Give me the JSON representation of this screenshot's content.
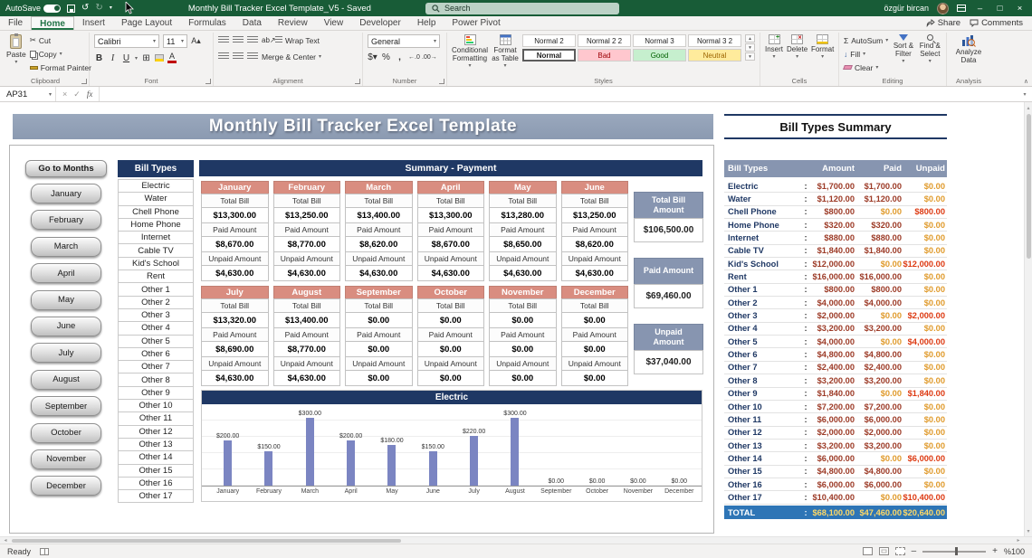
{
  "colors": {
    "titlebar-green": "#185c37",
    "tab-accent": "#217346",
    "navy": "#1f3864",
    "banner-blue": "#8b9ab1",
    "salmon": "#d98d80",
    "table-header": "#8795b0",
    "total-row-blue": "#2e75b6",
    "bar": "#7b85c2",
    "money": "#9c3a26",
    "zero-amount": "#e09b2d",
    "unpaid-pos": "#dd3a12",
    "total-values": "#ffd966",
    "bad-bg": "#ffc7ce",
    "bad-fg": "#9c0006",
    "good-bg": "#c6efce",
    "good-fg": "#006100",
    "neutral-bg": "#ffeb9c",
    "neutral-fg": "#9c6500"
  },
  "titlebar": {
    "autosave_label": "AutoSave",
    "autosave_state": "On",
    "doc_title": "Monthly Bill Tracker Excel Template_V5 - Saved",
    "search_placeholder": "Search",
    "user_name": "özgür bircan"
  },
  "ribbon": {
    "tabs": [
      "File",
      "Home",
      "Insert",
      "Page Layout",
      "Formulas",
      "Data",
      "Review",
      "View",
      "Developer",
      "Help",
      "Power Pivot"
    ],
    "active_tab": "Home",
    "share": "Share",
    "comments": "Comments",
    "groups": {
      "clipboard": {
        "label": "Clipboard",
        "paste": "Paste",
        "cut": "Cut",
        "copy": "Copy",
        "format_painter": "Format Painter"
      },
      "font": {
        "label": "Font",
        "family": "Calibri",
        "size": "11"
      },
      "alignment": {
        "label": "Alignment",
        "wrap_text": "Wrap Text",
        "merge_center": "Merge & Center"
      },
      "number": {
        "label": "Number",
        "format": "General"
      },
      "styles": {
        "label": "Styles",
        "conditional_formatting": "Conditional Formatting",
        "format_as_table": "Format as Table",
        "cell_styles": [
          {
            "name": "Normal 2",
            "kind": "plain"
          },
          {
            "name": "Normal 2 2",
            "kind": "plain"
          },
          {
            "name": "Normal 3",
            "kind": "plain"
          },
          {
            "name": "Normal 3 2",
            "kind": "plain"
          },
          {
            "name": "Normal",
            "kind": "selected"
          },
          {
            "name": "Bad",
            "kind": "bad"
          },
          {
            "name": "Good",
            "kind": "good"
          },
          {
            "name": "Neutral",
            "kind": "neutral"
          }
        ]
      },
      "cells": {
        "label": "Cells",
        "insert": "Insert",
        "delete": "Delete",
        "format": "Format"
      },
      "editing": {
        "label": "Editing",
        "autosum": "AutoSum",
        "fill": "Fill",
        "clear": "Clear",
        "sort_filter": "Sort & Filter",
        "find_select": "Find & Select"
      },
      "analysis": {
        "label": "Analysis",
        "analyze_data": "Analyze Data"
      }
    }
  },
  "formula_bar": {
    "name_box": "AP31",
    "formula": ""
  },
  "sheet": {
    "banner_title": "Monthly Bill Tracker Excel Template",
    "months_nav_header": "Go to Months",
    "months": [
      "January",
      "February",
      "March",
      "April",
      "May",
      "June",
      "July",
      "August",
      "September",
      "October",
      "November",
      "December"
    ],
    "bill_types_header": "Bill Types",
    "summary_header": "Summary - Payment",
    "card_labels": {
      "total": "Total Bill",
      "paid": "Paid Amount",
      "unpaid": "Unpaid Amount"
    },
    "cards": [
      {
        "month": "January",
        "total": "$13,300.00",
        "paid": "$8,670.00",
        "unpaid": "$4,630.00"
      },
      {
        "month": "February",
        "total": "$13,250.00",
        "paid": "$8,770.00",
        "unpaid": "$4,630.00"
      },
      {
        "month": "March",
        "total": "$13,400.00",
        "paid": "$8,620.00",
        "unpaid": "$4,630.00"
      },
      {
        "month": "April",
        "total": "$13,300.00",
        "paid": "$8,670.00",
        "unpaid": "$4,630.00"
      },
      {
        "month": "May",
        "total": "$13,280.00",
        "paid": "$8,650.00",
        "unpaid": "$4,630.00"
      },
      {
        "month": "June",
        "total": "$13,250.00",
        "paid": "$8,620.00",
        "unpaid": "$4,630.00"
      },
      {
        "month": "July",
        "total": "$13,320.00",
        "paid": "$8,690.00",
        "unpaid": "$4,630.00"
      },
      {
        "month": "August",
        "total": "$13,400.00",
        "paid": "$8,770.00",
        "unpaid": "$4,630.00"
      },
      {
        "month": "September",
        "total": "$0.00",
        "paid": "$0.00",
        "unpaid": "$0.00"
      },
      {
        "month": "October",
        "total": "$0.00",
        "paid": "$0.00",
        "unpaid": "$0.00"
      },
      {
        "month": "November",
        "total": "$0.00",
        "paid": "$0.00",
        "unpaid": "$0.00"
      },
      {
        "month": "December",
        "total": "$0.00",
        "paid": "$0.00",
        "unpaid": "$0.00"
      }
    ],
    "totals_boxes": [
      {
        "label": "Total Bill Amount",
        "value": "$106,500.00"
      },
      {
        "label": "Paid Amount",
        "value": "$69,460.00"
      },
      {
        "label": "Unpaid Amount",
        "value": "$37,040.00"
      }
    ]
  },
  "chart_data": {
    "type": "bar",
    "title": "Electric",
    "categories": [
      "January",
      "February",
      "March",
      "April",
      "May",
      "June",
      "July",
      "August",
      "September",
      "October",
      "November",
      "December"
    ],
    "values": [
      200,
      150,
      300,
      200,
      180,
      150,
      220,
      300,
      0,
      0,
      0,
      0
    ],
    "data_labels": [
      "$200.00",
      "$150.00",
      "$300.00",
      "$200.00",
      "$180.00",
      "$150.00",
      "$220.00",
      "$300.00",
      "$0.00",
      "$0.00",
      "$0.00",
      "$0.00"
    ],
    "xlabel": "",
    "ylabel": "",
    "ylim": [
      0,
      350
    ],
    "grid": true,
    "legend": "none"
  },
  "summary_table": {
    "title": "Bill Types Summary",
    "headers": [
      "Bill Types",
      "Amount",
      "Paid",
      "Unpaid"
    ],
    "separator": ":",
    "rows": [
      {
        "name": "Electric",
        "amount": "$1,700.00",
        "paid": "$1,700.00",
        "unpaid": "$0.00"
      },
      {
        "name": "Water",
        "amount": "$1,120.00",
        "paid": "$1,120.00",
        "unpaid": "$0.00"
      },
      {
        "name": "Chell Phone",
        "amount": "$800.00",
        "paid": "$0.00",
        "unpaid": "$800.00"
      },
      {
        "name": "Home Phone",
        "amount": "$320.00",
        "paid": "$320.00",
        "unpaid": "$0.00"
      },
      {
        "name": "Internet",
        "amount": "$880.00",
        "paid": "$880.00",
        "unpaid": "$0.00"
      },
      {
        "name": "Cable TV",
        "amount": "$1,840.00",
        "paid": "$1,840.00",
        "unpaid": "$0.00"
      },
      {
        "name": "Kid's School",
        "amount": "$12,000.00",
        "paid": "$0.00",
        "unpaid": "$12,000.00"
      },
      {
        "name": "Rent",
        "amount": "$16,000.00",
        "paid": "$16,000.00",
        "unpaid": "$0.00"
      },
      {
        "name": "Other 1",
        "amount": "$800.00",
        "paid": "$800.00",
        "unpaid": "$0.00"
      },
      {
        "name": "Other 2",
        "amount": "$4,000.00",
        "paid": "$4,000.00",
        "unpaid": "$0.00"
      },
      {
        "name": "Other 3",
        "amount": "$2,000.00",
        "paid": "$0.00",
        "unpaid": "$2,000.00"
      },
      {
        "name": "Other 4",
        "amount": "$3,200.00",
        "paid": "$3,200.00",
        "unpaid": "$0.00"
      },
      {
        "name": "Other 5",
        "amount": "$4,000.00",
        "paid": "$0.00",
        "unpaid": "$4,000.00"
      },
      {
        "name": "Other 6",
        "amount": "$4,800.00",
        "paid": "$4,800.00",
        "unpaid": "$0.00"
      },
      {
        "name": "Other 7",
        "amount": "$2,400.00",
        "paid": "$2,400.00",
        "unpaid": "$0.00"
      },
      {
        "name": "Other 8",
        "amount": "$3,200.00",
        "paid": "$3,200.00",
        "unpaid": "$0.00"
      },
      {
        "name": "Other 9",
        "amount": "$1,840.00",
        "paid": "$0.00",
        "unpaid": "$1,840.00"
      },
      {
        "name": "Other 10",
        "amount": "$7,200.00",
        "paid": "$7,200.00",
        "unpaid": "$0.00"
      },
      {
        "name": "Other 11",
        "amount": "$6,000.00",
        "paid": "$6,000.00",
        "unpaid": "$0.00"
      },
      {
        "name": "Other 12",
        "amount": "$2,000.00",
        "paid": "$2,000.00",
        "unpaid": "$0.00"
      },
      {
        "name": "Other 13",
        "amount": "$3,200.00",
        "paid": "$3,200.00",
        "unpaid": "$0.00"
      },
      {
        "name": "Other 14",
        "amount": "$6,000.00",
        "paid": "$0.00",
        "unpaid": "$6,000.00"
      },
      {
        "name": "Other 15",
        "amount": "$4,800.00",
        "paid": "$4,800.00",
        "unpaid": "$0.00"
      },
      {
        "name": "Other 16",
        "amount": "$6,000.00",
        "paid": "$6,000.00",
        "unpaid": "$0.00"
      },
      {
        "name": "Other 17",
        "amount": "$10,400.00",
        "paid": "$0.00",
        "unpaid": "$10,400.00"
      }
    ],
    "total_row": {
      "name": "TOTAL",
      "amount": "$68,100.00",
      "paid": "$47,460.00",
      "unpaid": "$20,640.00"
    }
  },
  "status_bar": {
    "mode": "Ready",
    "zoom": "%100"
  }
}
